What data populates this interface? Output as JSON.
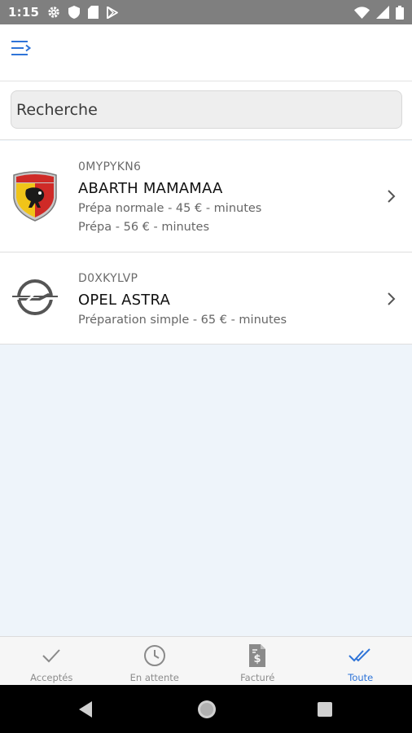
{
  "status_bar": {
    "time": "1:15",
    "left_icons": [
      "settings-icon",
      "shield-icon",
      "sd-card-icon",
      "play-store-icon"
    ],
    "right_icons": [
      "wifi-icon",
      "signal-icon",
      "battery-icon"
    ]
  },
  "app_bar": {
    "menu_icon": "menu-icon"
  },
  "search": {
    "placeholder": "Recherche",
    "value": ""
  },
  "items": [
    {
      "code": "0MYPYKN6",
      "title": "ABARTH MAMAMAA",
      "lines": [
        "Prépa normale - 45 € -  minutes",
        "Prépa - 56 € -  minutes"
      ],
      "logo": "abarth-logo"
    },
    {
      "code": "D0XKYLVP",
      "title": "OPEL ASTRA",
      "lines": [
        "Préparation simple - 65 € -  minutes"
      ],
      "logo": "opel-logo"
    }
  ],
  "tabs": [
    {
      "label": "Acceptés",
      "icon": "check-icon",
      "active": false
    },
    {
      "label": "En attente",
      "icon": "clock-icon",
      "active": false
    },
    {
      "label": "Facturé",
      "icon": "invoice-icon",
      "active": false
    },
    {
      "label": "Toute",
      "icon": "double-check-icon",
      "active": true
    }
  ],
  "colors": {
    "accent": "#2f74d8",
    "status_bar": "#7f7f7f",
    "list_background": "#eef4fa"
  }
}
